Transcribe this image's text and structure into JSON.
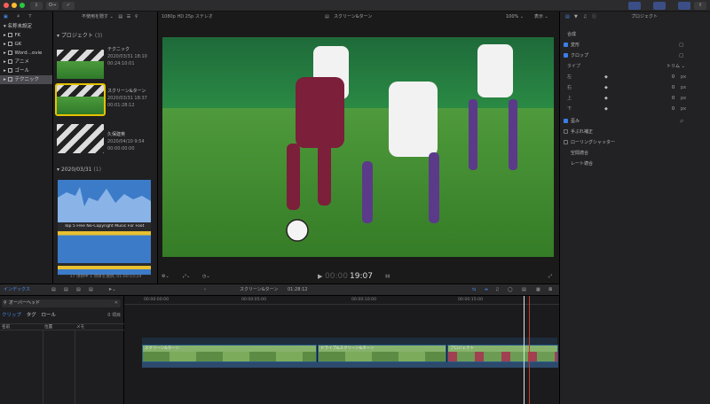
{
  "titlebar": {
    "key_label": "O→"
  },
  "library": {
    "title": "名称未設定",
    "events": [
      "FK",
      "GK",
      "Word...ovie",
      "アニメ",
      "ゴール",
      "テクニック"
    ],
    "selected": 5
  },
  "browser": {
    "filter": "不使用を隠す",
    "projects_label": "プロジェクト",
    "projects_count": "(3)",
    "projects": [
      {
        "name": "テクニック",
        "date": "2020/03/31 18:10",
        "duration": "00:24:10:01"
      },
      {
        "name": "スクリーン&ターン",
        "date": "2020/03/31 18:37",
        "duration": "00:01:28:12"
      },
      {
        "name": "久保建英",
        "date": "2020/04/10 9:54",
        "duration": "00:00:00:00"
      }
    ],
    "date_group": "2020/03/31",
    "date_count": "(1)",
    "media_title": "Top 5 Free No-Copyright Music For Foot",
    "status": "17 項目中 1 項目を選択, 01:00:15:24"
  },
  "viewer": {
    "format": "1080p HD 25p ステレオ",
    "project": "スクリーン&ターン",
    "zoom": "100%",
    "view_label": "表示",
    "timecode_dim": "00:00",
    "timecode": "19:07"
  },
  "inspector": {
    "title": "プロジェクト",
    "composite": "合成",
    "transform": "変形",
    "crop": "クロップ",
    "type_label": "タイプ",
    "type_value": "トリム",
    "fields": [
      {
        "label": "左",
        "value": "0",
        "unit": "px"
      },
      {
        "label": "右",
        "value": "0",
        "unit": "px"
      },
      {
        "label": "上",
        "value": "0",
        "unit": "px"
      },
      {
        "label": "下",
        "value": "0",
        "unit": "px"
      }
    ],
    "distort": "歪み",
    "stabilize": "手ぶれ補正",
    "rolling": "ローリングシャッター",
    "spatial": "空間適合",
    "rate": "レート適合"
  },
  "timeline_bar": {
    "index_label": "インデックス",
    "project": "スクリーン&ターン",
    "duration": "01:28:12"
  },
  "index": {
    "search_value": "オーバーヘッド",
    "tabs": [
      "クリップ",
      "タグ",
      "ロール"
    ],
    "count": "0 項目",
    "columns": [
      "名前",
      "位置",
      "メモ"
    ]
  },
  "timeline": {
    "ruler": [
      "00:00:00:00",
      "00:00:05:00",
      "00:00:10:00",
      "00:00:15:00"
    ],
    "clips": [
      "スクリーン&ターン",
      "ドライブ&スクリーン&ターン",
      "プロジェクト"
    ]
  }
}
